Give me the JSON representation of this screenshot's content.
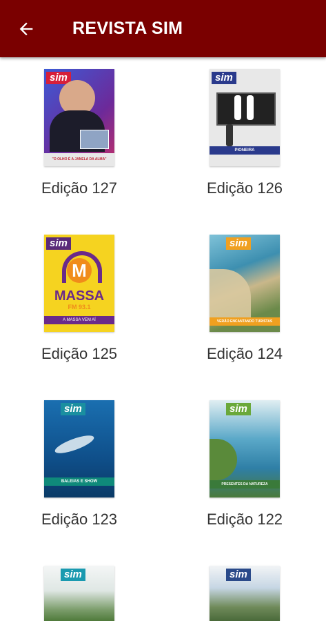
{
  "appbar": {
    "title": "REVISTA SIM",
    "back_icon": "arrow-left-icon"
  },
  "colors": {
    "appbar": "#7a0000"
  },
  "issues": [
    {
      "label": "Edição 127",
      "logo": "sim",
      "cover_text": "\"O OLHO É A JANELA DA ALMA\""
    },
    {
      "label": "Edição 126",
      "logo": "sim",
      "cover_text": "PIONEIRA"
    },
    {
      "label": "Edição 125",
      "logo": "sim",
      "cover_text": "MASSA",
      "cover_sub": "FM 93.1",
      "cover_footer": "A MASSA VEM AÍ"
    },
    {
      "label": "Edição 124",
      "logo": "sim",
      "cover_text": "VERÃO ENCANTANDO TURISTAS"
    },
    {
      "label": "Edição 123",
      "logo": "sim",
      "cover_text": "BALEIAS E SHOW"
    },
    {
      "label": "Edição 122",
      "logo": "sim",
      "cover_text": "PRESENTES DA NATUREZA"
    },
    {
      "label": "",
      "logo": "sim"
    },
    {
      "label": "",
      "logo": "sim"
    }
  ]
}
